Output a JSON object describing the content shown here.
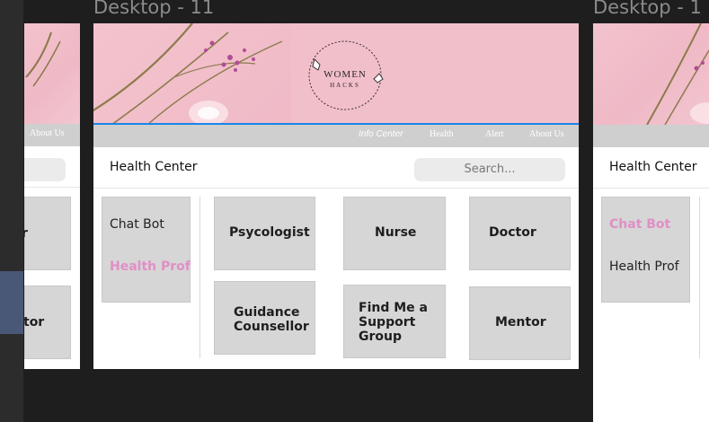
{
  "frames": {
    "main_title": "Desktop - 11",
    "right_title": "Desktop - 1"
  },
  "logo": {
    "line1": "WOMEN",
    "line2": "HACKS"
  },
  "nav": {
    "info_center": "Info Center",
    "health": "Health",
    "alert": "Alert",
    "about": "About Us"
  },
  "header": {
    "title": "Health Center",
    "search_placeholder": "Search..."
  },
  "sidebar": {
    "chat_bot": "Chat Bot",
    "health_prof": "Health Prof"
  },
  "cards": {
    "psycologist": "Psycologist",
    "nurse": "Nurse",
    "doctor": "Doctor",
    "guidance": "Guidance Counsellor",
    "support_group": "Find Me a Support Group",
    "mentor": "Mentor"
  },
  "left_partial": {
    "about": "About Us",
    "card1_tail": "r",
    "card2_tail": "tor"
  },
  "colors": {
    "selection": "#1b86e8",
    "accent_pink": "#e08fc6",
    "canvas": "#1e1e1e"
  }
}
